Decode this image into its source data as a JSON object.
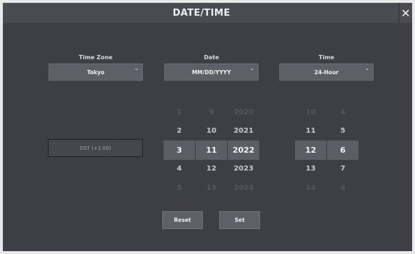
{
  "dialog": {
    "title": "DATE/TIME",
    "close_label": "✕"
  },
  "timezone": {
    "label": "Time Zone",
    "value": "Tokyo"
  },
  "date": {
    "label": "Date",
    "value": "MM/DD/YYYY"
  },
  "time": {
    "label": "Time",
    "value": "24-Hour"
  },
  "dst": {
    "label": "DST (+1:00)"
  },
  "date_picker": {
    "month": [
      "1",
      "2",
      "3",
      "4",
      "5"
    ],
    "day": [
      "9",
      "10",
      "11",
      "12",
      "13"
    ],
    "year": [
      "2020",
      "2021",
      "2022",
      "2023",
      "2024"
    ]
  },
  "time_picker": {
    "hour": [
      "10",
      "11",
      "12",
      "13",
      "14"
    ],
    "minute": [
      "4",
      "5",
      "6",
      "7",
      "8"
    ]
  },
  "selected_index": 2,
  "buttons": {
    "reset": "Reset",
    "set": "Set"
  }
}
